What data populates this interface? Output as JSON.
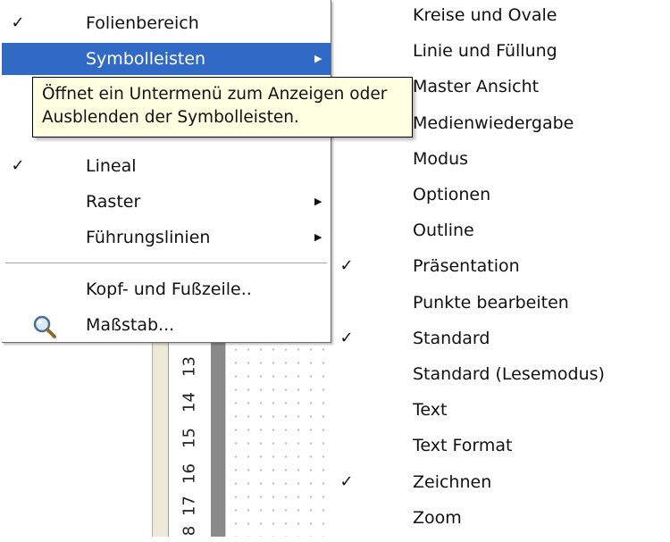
{
  "menu": {
    "items": [
      {
        "label": "Folienbereich",
        "checked": true,
        "submenu": false,
        "selected": false
      },
      {
        "label": "Symbolleisten",
        "checked": false,
        "submenu": true,
        "selected": true
      },
      {
        "label": "Lineal",
        "checked": true,
        "submenu": false,
        "selected": false
      },
      {
        "label": "Raster",
        "checked": false,
        "submenu": true,
        "selected": false
      },
      {
        "label": "Führungslinien",
        "checked": false,
        "submenu": true,
        "selected": false
      },
      {
        "label": "Kopf- und Fußzeile..",
        "checked": false,
        "submenu": false,
        "selected": false
      },
      {
        "label": "Maßstab...",
        "checked": false,
        "submenu": false,
        "selected": false,
        "icon": "magnifier-icon"
      }
    ],
    "check_glyph": "✓",
    "arrow_glyph": "▶"
  },
  "tooltip": {
    "line1": "Öffnet ein Untermenü zum Anzeigen oder",
    "line2": "Ausblenden der Symbolleisten."
  },
  "submenu": {
    "items": [
      {
        "label": "Kreise und Ovale",
        "checked": false
      },
      {
        "label": "Linie und Füllung",
        "checked": false
      },
      {
        "label": "Master Ansicht",
        "checked": false
      },
      {
        "label": "Medienwiedergabe",
        "checked": false
      },
      {
        "label": "Modus",
        "checked": false
      },
      {
        "label": "Optionen",
        "checked": false
      },
      {
        "label": "Outline",
        "checked": false
      },
      {
        "label": "Präsentation",
        "checked": true
      },
      {
        "label": "Punkte bearbeiten",
        "checked": false
      },
      {
        "label": "Standard",
        "checked": true
      },
      {
        "label": "Standard (Lesemodus)",
        "checked": false
      },
      {
        "label": "Text",
        "checked": false
      },
      {
        "label": "Text Format",
        "checked": false
      },
      {
        "label": "Zeichnen",
        "checked": true
      },
      {
        "label": "Zoom",
        "checked": false
      }
    ]
  },
  "ruler": {
    "numbers": [
      "13",
      "14",
      "15",
      "16",
      "17",
      "8"
    ]
  },
  "colors": {
    "selection": "#316ac5",
    "tooltip_bg": "#ffffe1"
  }
}
